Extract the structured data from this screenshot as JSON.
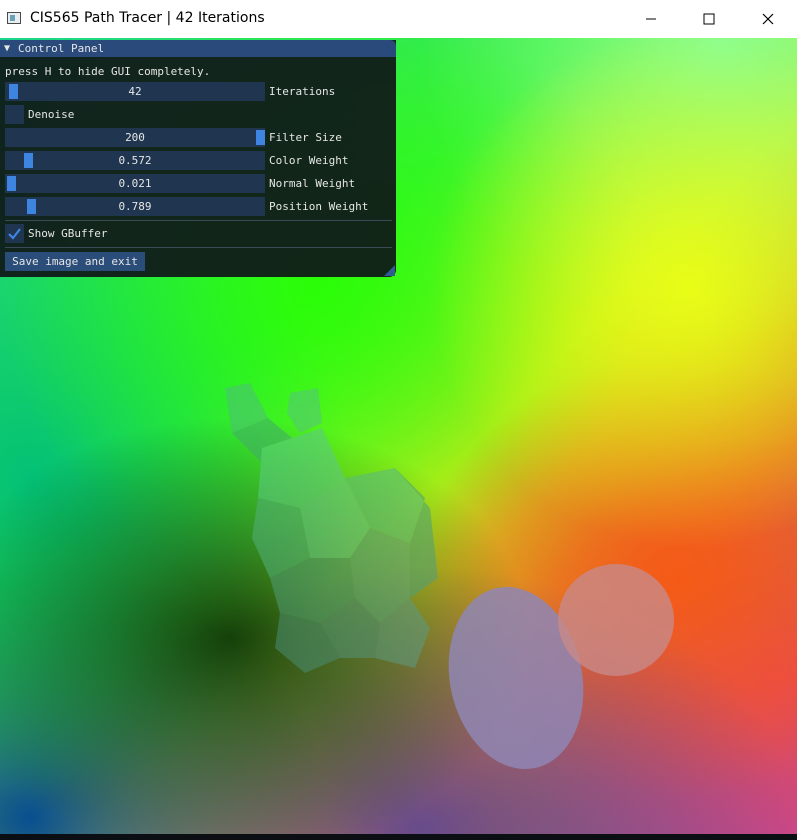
{
  "window": {
    "title": "CIS565 Path Tracer | 42 Iterations",
    "icon": "app-window-icon",
    "controls": [
      "minimize-icon",
      "maximize-icon",
      "close-icon"
    ]
  },
  "panel": {
    "title": "Control Panel",
    "hint": "press H to hide GUI completely.",
    "iterations": {
      "value": "42",
      "label": "Iterations",
      "fraction": 0.01
    },
    "denoise": {
      "label": "Denoise",
      "checked": false
    },
    "filter_size": {
      "value": "200",
      "label": "Filter Size",
      "fraction": 1.0
    },
    "color_weight": {
      "value": "0.572",
      "label": "Color Weight",
      "fraction": 0.07
    },
    "normal_weight": {
      "value": "0.021",
      "label": "Normal Weight",
      "fraction": 0.0
    },
    "position_weight": {
      "value": "0.789",
      "label": "Position Weight",
      "fraction": 0.08
    },
    "show_gbuffer": {
      "label": "Show GBuffer",
      "checked": true
    },
    "save_button": "Save image and exit"
  },
  "colors": {
    "panel_bg": "#101818",
    "header": "#294a7a",
    "frame": "#1f3550",
    "grab": "#3d85e0",
    "button": "#2b4d7a",
    "text": "#e6e6e6"
  }
}
